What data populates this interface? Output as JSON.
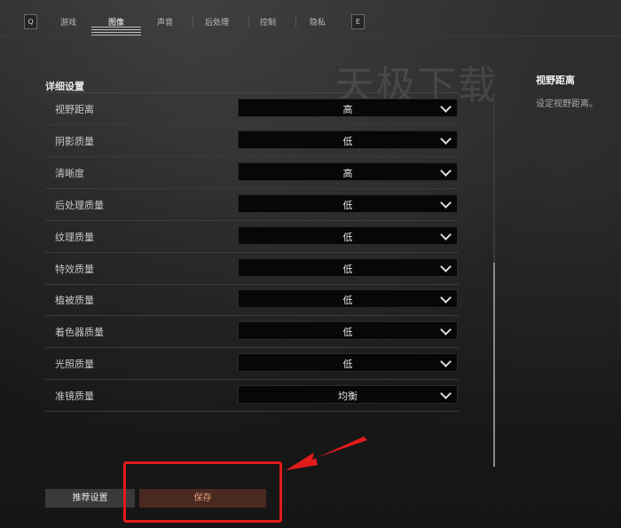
{
  "topbar": {
    "left_key": "Q",
    "right_key": "E",
    "tabs": [
      {
        "label": "游戏"
      },
      {
        "label": "图像"
      },
      {
        "label": "声音"
      },
      {
        "label": "后处理"
      },
      {
        "label": "控制"
      },
      {
        "label": "隐私"
      }
    ],
    "active_tab": "图像"
  },
  "watermark": "天极下载",
  "section": {
    "title": "详细设置"
  },
  "settings": [
    {
      "label": "视野距离",
      "value": "高"
    },
    {
      "label": "阴影质量",
      "value": "低"
    },
    {
      "label": "清晰度",
      "value": "高"
    },
    {
      "label": "后处理质量",
      "value": "低"
    },
    {
      "label": "纹理质量",
      "value": "低"
    },
    {
      "label": "特效质量",
      "value": "低"
    },
    {
      "label": "植被质量",
      "value": "低"
    },
    {
      "label": "着色器质量",
      "value": "低"
    },
    {
      "label": "光照质量",
      "value": "低"
    },
    {
      "label": "准镜质量",
      "value": "均衡"
    }
  ],
  "description": {
    "title": "视野距离",
    "text": "设定视野距离。"
  },
  "buttons": {
    "recommend": "推荐设置",
    "save": "保存"
  },
  "colors": {
    "accent_save_bg": "#4a2a20",
    "accent_save_text": "#e2a07c",
    "annotation_red": "#e21b1b"
  }
}
